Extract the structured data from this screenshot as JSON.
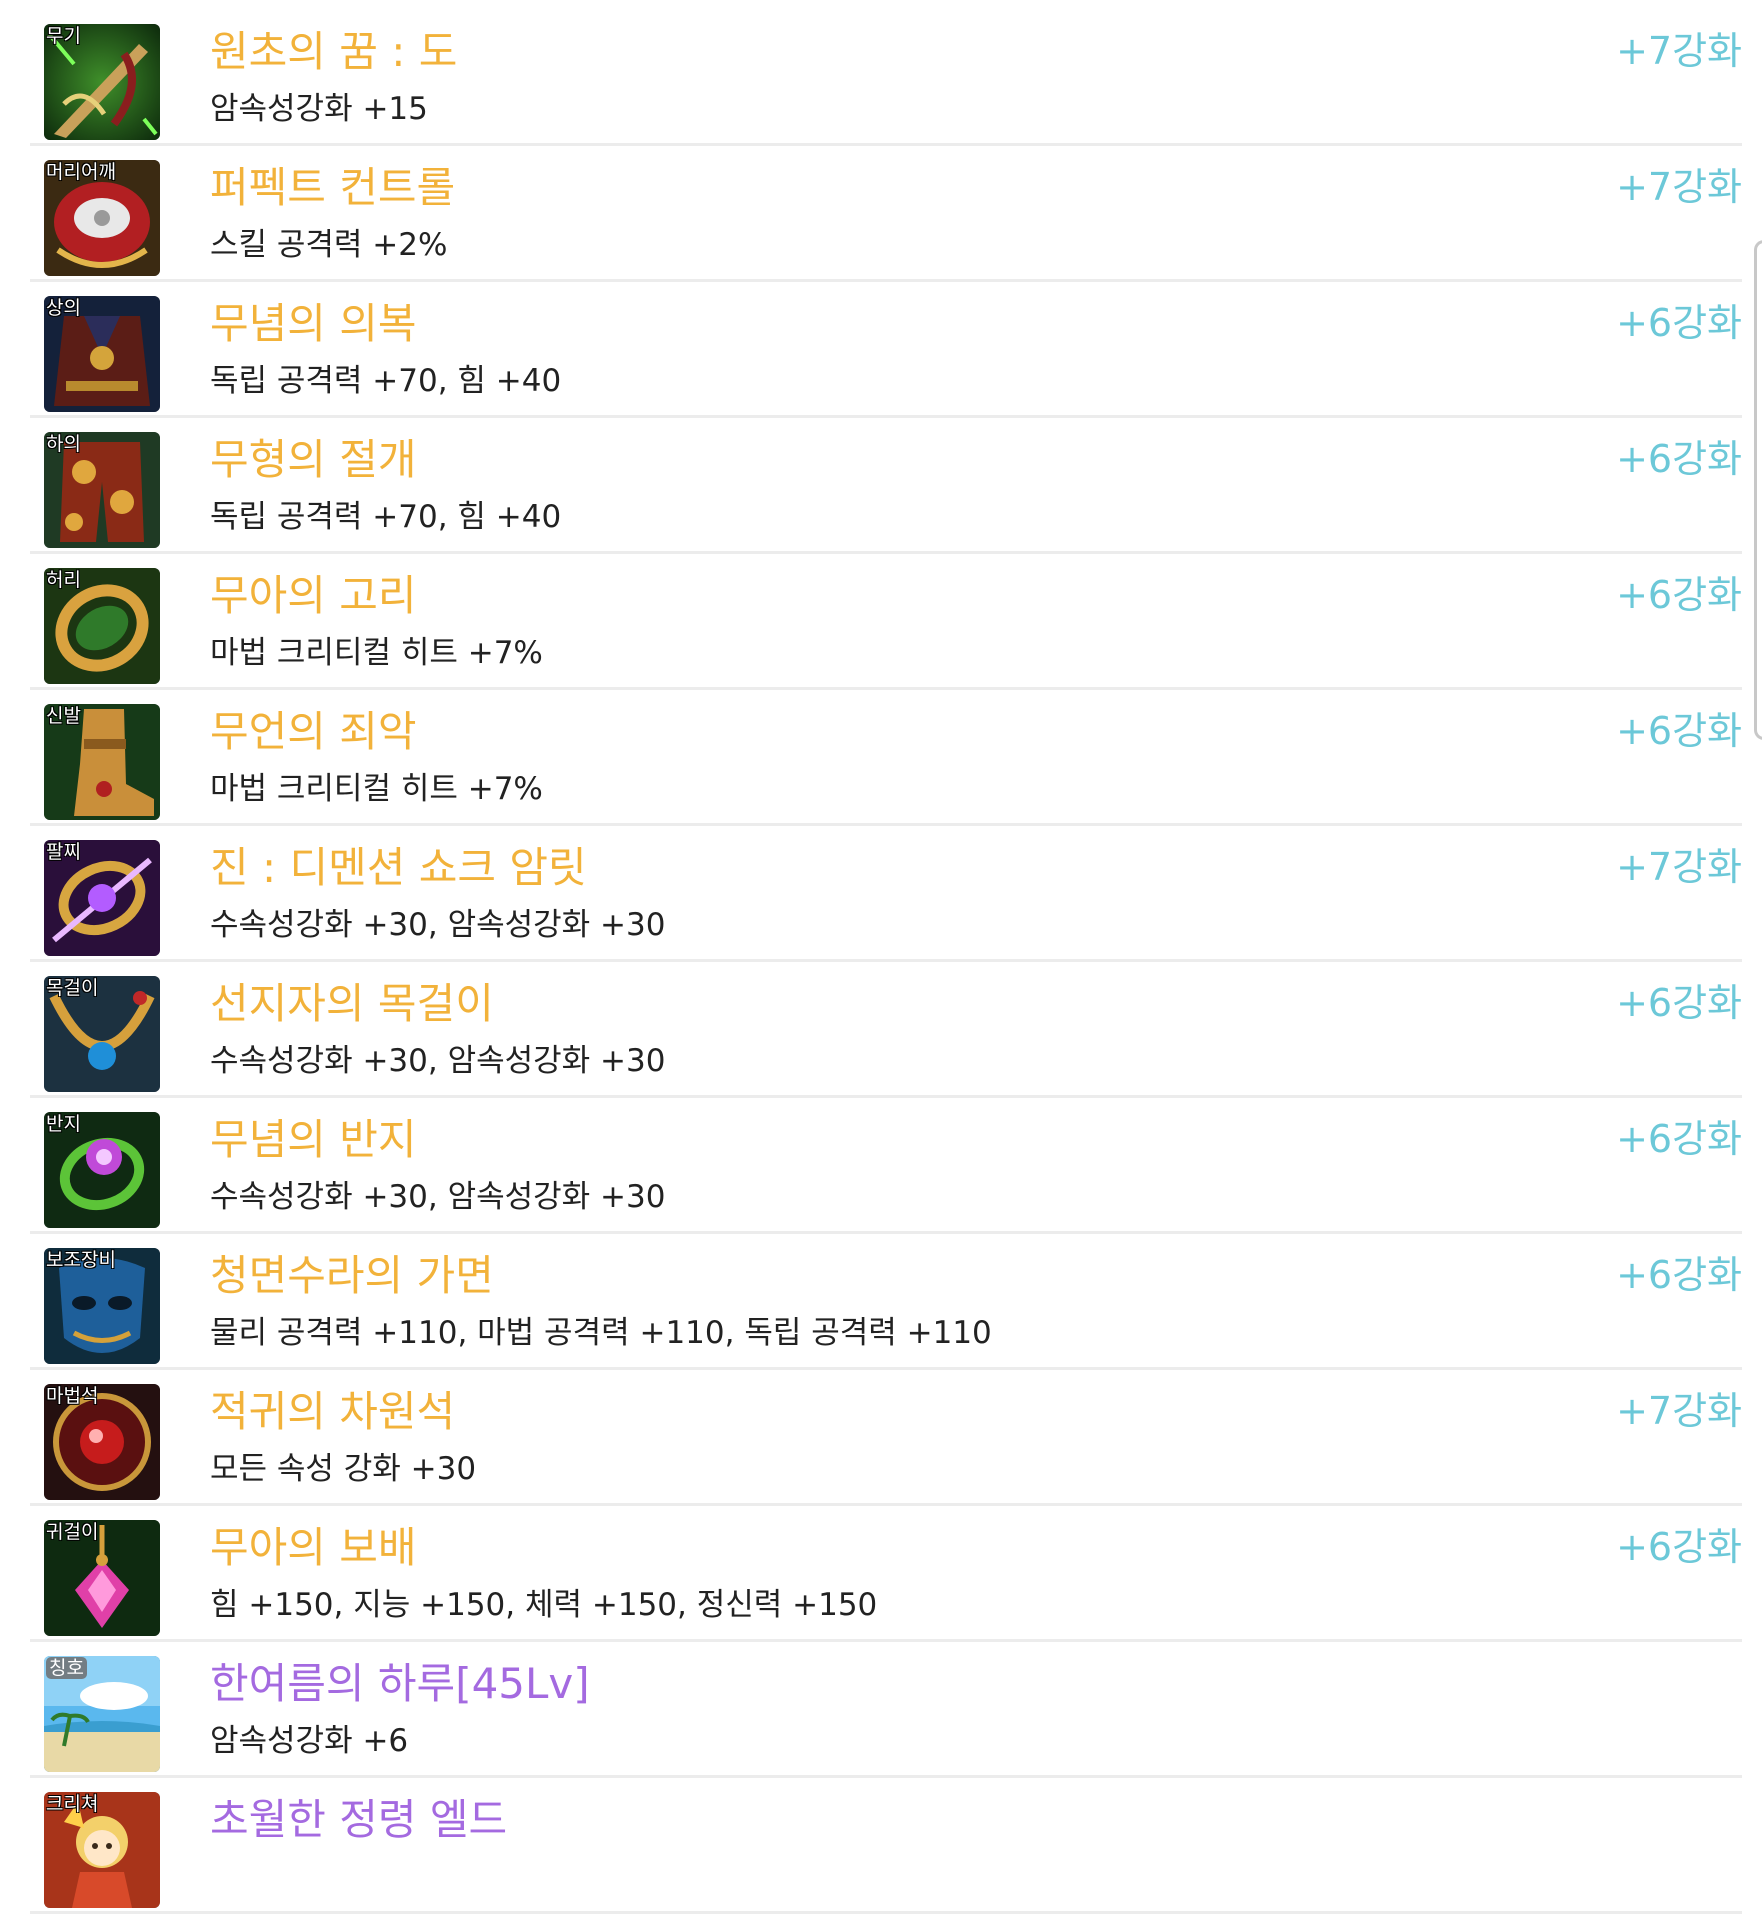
{
  "items": [
    {
      "slot": "무기",
      "name": "원초의 꿈 : 도",
      "stat": "암속성강화 +15",
      "enhance": "+7강화",
      "color": "#f2b23a",
      "icon": "sword-icon"
    },
    {
      "slot": "머리어깨",
      "name": "퍼펙트 컨트롤",
      "stat": "스킬 공격력 +2%",
      "enhance": "+7강화",
      "color": "#f2b23a",
      "icon": "shoulder-armor-icon"
    },
    {
      "slot": "상의",
      "name": "무념의 의복",
      "stat": "독립 공격력 +70, 힘 +40",
      "enhance": "+6강화",
      "color": "#f2b23a",
      "icon": "top-armor-icon"
    },
    {
      "slot": "하의",
      "name": "무형의 절개",
      "stat": "독립 공격력 +70, 힘 +40",
      "enhance": "+6강화",
      "color": "#f2b23a",
      "icon": "pants-armor-icon"
    },
    {
      "slot": "허리",
      "name": "무아의 고리",
      "stat": "마법 크리티컬 히트 +7%",
      "enhance": "+6강화",
      "color": "#f2b23a",
      "icon": "belt-icon"
    },
    {
      "slot": "신발",
      "name": "무언의 죄악",
      "stat": "마법 크리티컬 히트 +7%",
      "enhance": "+6강화",
      "color": "#f2b23a",
      "icon": "boots-icon"
    },
    {
      "slot": "팔찌",
      "name": "진 : 디멘션 쇼크 암릿",
      "stat": "수속성강화 +30, 암속성강화 +30",
      "enhance": "+7강화",
      "color": "#f2b23a",
      "icon": "bracelet-icon"
    },
    {
      "slot": "목걸이",
      "name": "선지자의 목걸이",
      "stat": "수속성강화 +30, 암속성강화 +30",
      "enhance": "+6강화",
      "color": "#f2b23a",
      "icon": "necklace-icon"
    },
    {
      "slot": "반지",
      "name": "무념의 반지",
      "stat": "수속성강화 +30, 암속성강화 +30",
      "enhance": "+6강화",
      "color": "#f2b23a",
      "icon": "ring-icon"
    },
    {
      "slot": "보조장비",
      "name": "청면수라의 가면",
      "stat": "물리 공격력 +110, 마법 공격력 +110, 독립 공격력 +110",
      "enhance": "+6강화",
      "color": "#f2b23a",
      "icon": "mask-icon"
    },
    {
      "slot": "마법석",
      "name": "적귀의 차원석",
      "stat": "모든 속성 강화 +30",
      "enhance": "+7강화",
      "color": "#f2b23a",
      "icon": "magic-stone-icon"
    },
    {
      "slot": "귀걸이",
      "name": "무아의 보배",
      "stat": "힘 +150, 지능 +150, 체력 +150, 정신력 +150",
      "enhance": "+6강화",
      "color": "#f2b23a",
      "icon": "earring-icon"
    },
    {
      "slot": "칭호",
      "name": "한여름의 하루[45Lv]",
      "stat": "암속성강화 +6",
      "enhance": "",
      "color": "#a46ae0",
      "icon": "title-icon"
    },
    {
      "slot": "크리쳐",
      "name": "초월한 정령 엘드",
      "stat": "",
      "enhance": "",
      "color": "#a46ae0",
      "icon": "creature-icon"
    }
  ]
}
